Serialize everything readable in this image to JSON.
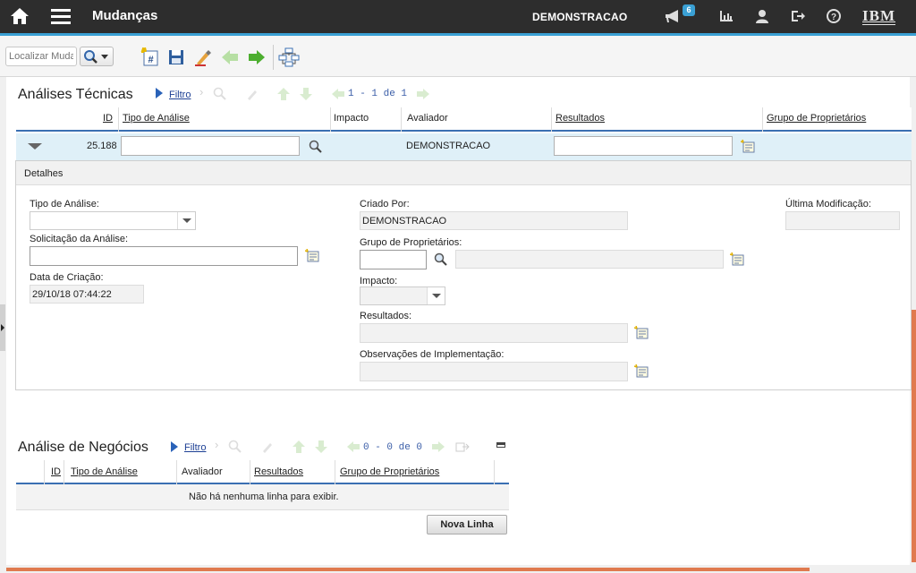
{
  "header": {
    "app_title": "Mudanças",
    "user": "DEMONSTRACAO",
    "notification_count": "6",
    "brand": "IBM"
  },
  "toolbar": {
    "find_placeholder": "Localizar Mudança"
  },
  "technical": {
    "title": "Análises Técnicas",
    "filter_label": "Filtro",
    "pager": "1 - 1 de 1",
    "columns": [
      "ID",
      "Tipo de Análise",
      "Impacto",
      "Avaliador",
      "Resultados",
      "Grupo de Proprietários"
    ],
    "row": {
      "id": "25.188",
      "analysis_type": "",
      "evaluator": "DEMONSTRACAO",
      "results": ""
    },
    "details": {
      "heading": "Detalhes",
      "analysis_type_label": "Tipo de Análise:",
      "analysis_request_label": "Solicitação da Análise:",
      "created_date_label": "Data de Criação:",
      "created_date": "29/10/18 07:44:22",
      "created_by_label": "Criado Por:",
      "created_by": "DEMONSTRACAO",
      "owner_group_label": "Grupo de Proprietários:",
      "impact_label": "Impacto:",
      "results_label": "Resultados:",
      "impl_notes_label": "Observações de Implementação:",
      "last_modified_label": "Última Modificação:"
    }
  },
  "business": {
    "title": "Análise de Negócios",
    "filter_label": "Filtro",
    "pager": "0 - 0 de 0",
    "columns": [
      "ID",
      "Tipo de Análise",
      "Avaliador",
      "Resultados",
      "Grupo de Proprietários"
    ],
    "empty_message": "Não há nenhuma linha para exibir.",
    "new_row_button": "Nova Linha"
  },
  "colors": {
    "topbar": "#2d2d2d",
    "accent": "#3aa0d4",
    "header_rule": "#3a6fb2",
    "selected_row": "#dff0f8",
    "scroll_accent": "#e07a4f"
  }
}
